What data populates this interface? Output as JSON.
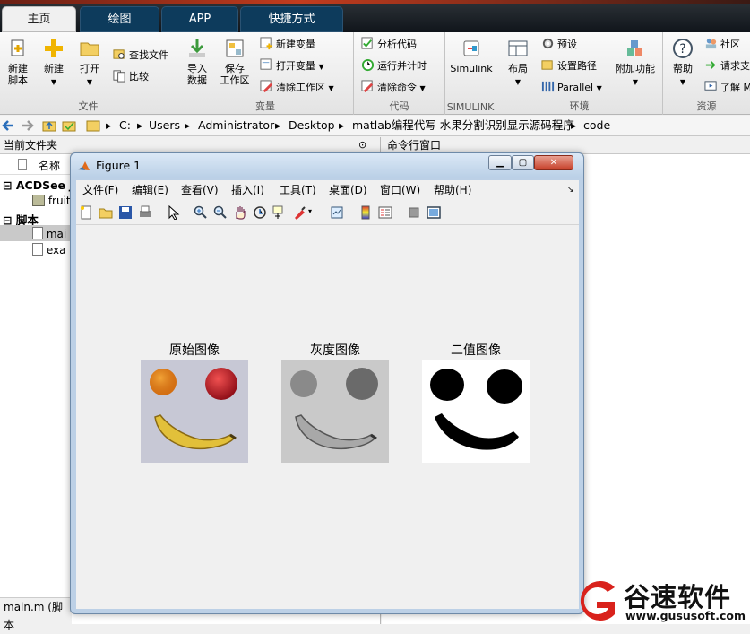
{
  "tabs": [
    "主页",
    "绘图",
    "APP",
    "快捷方式"
  ],
  "ribbon": {
    "file": {
      "label": "文件",
      "new_script": "新建\n脚本",
      "new": "新建",
      "open": "打开",
      "find_files": "查找文件",
      "compare": "比较"
    },
    "variable": {
      "label": "变量",
      "import": "导入\n数据",
      "save_ws": "保存\n工作区",
      "new_var": "新建变量",
      "open_var": "打开变量",
      "clear_ws": "清除工作区"
    },
    "code": {
      "label": "代码",
      "analyze": "分析代码",
      "run_time": "运行并计时",
      "clear_cmd": "清除命令"
    },
    "simulink": {
      "label": "SIMULINK",
      "btn": "Simulink"
    },
    "env": {
      "label": "环境",
      "layout": "布局",
      "prefs": "预设",
      "set_path": "设置路径",
      "parallel": "Parallel",
      "addons": "附加功能"
    },
    "resources": {
      "label": "资源",
      "help": "帮助",
      "community": "社区",
      "request": "请求支",
      "learn": "了解 M"
    }
  },
  "address": [
    "C:",
    "Users",
    "Administrator",
    "Desktop",
    "matlab编程代写 水果分割识别显示源码程序",
    "code"
  ],
  "left_panel": {
    "title": "当前文件夹",
    "col_name": "名称",
    "group1": "ACDSee J",
    "file1": "fruit",
    "group2": "脚本",
    "file2": "mai",
    "file3": "exa"
  },
  "cmd_title": "命令行窗口",
  "figure": {
    "title": "Figure 1",
    "menu": [
      "文件(F)",
      "编辑(E)",
      "查看(V)",
      "插入(I)",
      "工具(T)",
      "桌面(D)",
      "窗口(W)",
      "帮助(H)"
    ],
    "images": [
      "原始图像",
      "灰度图像",
      "二值图像"
    ]
  },
  "status_text": "main.m  (脚本",
  "logo": {
    "text": "谷速软件",
    "url": "www.gususoft.com"
  }
}
